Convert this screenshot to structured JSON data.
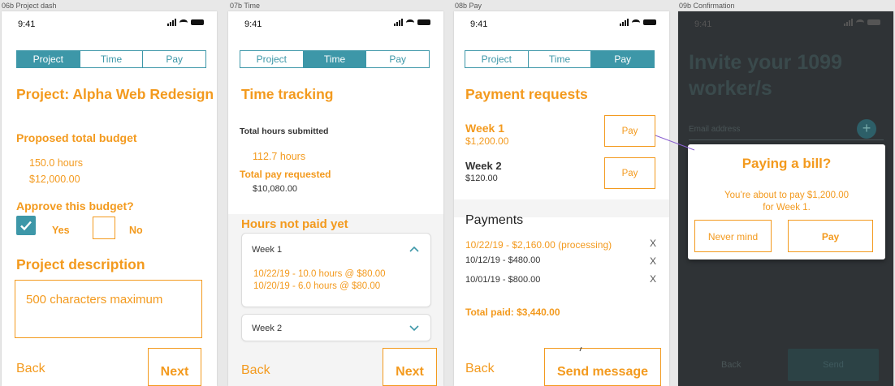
{
  "labels": {
    "s1": "06b Project dash",
    "s2": "07b Time",
    "s3": "08b Pay",
    "s4": "09b Confirmation"
  },
  "status_time": "9:41",
  "tabs": [
    "Project",
    "Time",
    "Pay"
  ],
  "project": {
    "title": "Project: Alpha Web Redesign",
    "budget_heading": "Proposed total budget",
    "budget_hours": "150.0 hours",
    "budget_amount": "$12,000.00",
    "approve_heading": "Approve this budget?",
    "yes_label": "Yes",
    "no_label": "No",
    "yes_checked": true,
    "description_heading": "Project description",
    "description_placeholder": "500 characters maximum",
    "back_label": "Back",
    "next_label": "Next"
  },
  "time": {
    "title": "Time tracking",
    "total_hours_label": "Total hours submitted",
    "total_hours_value": "112.7 hours",
    "total_pay_label": "Total pay requested",
    "total_pay_value": "$10,080.00",
    "unpaid_heading": "Hours not paid yet",
    "week1_label": "Week 1",
    "week1_entries": [
      "10/22/19 - 10.0 hours @ $80.00",
      "10/20/19 - 6.0 hours @ $80.00"
    ],
    "week2_label": "Week 2",
    "back_label": "Back",
    "next_label": "Next"
  },
  "pay": {
    "title": "Payment requests",
    "requests": [
      {
        "week": "Week 1",
        "amount": "$1,200.00",
        "pay_label": "Pay"
      },
      {
        "week": "Week 2",
        "amount": "$120.00",
        "pay_label": "Pay"
      }
    ],
    "payments_heading": "Payments",
    "payments": [
      {
        "text": "10/22/19 - $2,160.00  (processing)",
        "remove": "X"
      },
      {
        "text": "10/12/19 - $480.00",
        "remove": "X"
      },
      {
        "text": "10/01/19 - $800.00",
        "remove": "X"
      }
    ],
    "total_paid": "Total paid: $3,440.00",
    "back_label": "Back",
    "send_label": "Send message"
  },
  "confirm": {
    "bg_title": "Invite your 1099 worker/s",
    "email_placeholder": "Email address",
    "modal_title": "Paying a bill?",
    "modal_text": "You’re about to pay $1,200.00 for Week 1.",
    "never_label": "Never mind",
    "pay_label": "Pay",
    "back_label": "Back",
    "send_label": "Send"
  },
  "colors": {
    "accent_orange": "#f39a1e",
    "tab_teal": "#3d97a8",
    "dark_bg": "#2f3336"
  }
}
